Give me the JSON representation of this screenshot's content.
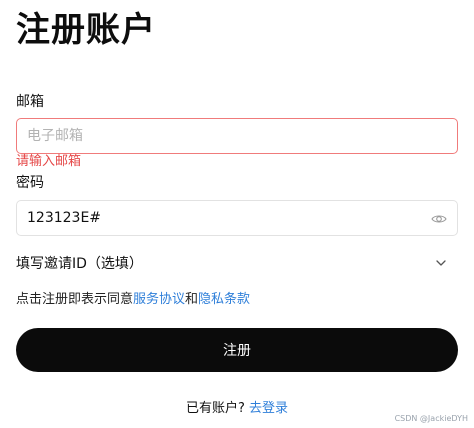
{
  "page": {
    "title": "注册账户"
  },
  "email": {
    "label": "邮箱",
    "placeholder": "电子邮箱",
    "value": "",
    "error": "请输入邮箱"
  },
  "password": {
    "label": "密码",
    "value": "123123E#",
    "icon": "eye-icon"
  },
  "invite": {
    "label": "填写邀请ID（选填）",
    "icon": "chevron-down-icon"
  },
  "agreement": {
    "prefix": "点击注册即表示同意",
    "service_link": "服务协议",
    "conj": "和",
    "privacy_link": "隐私条款"
  },
  "submit": {
    "label": "注册"
  },
  "login": {
    "prompt": "已有账户?",
    "link": "去登录"
  },
  "watermark": "CSDN @JackieDYH",
  "colors": {
    "error": "#e54848",
    "link": "#2f7fd9",
    "button_bg": "#0b0b0b"
  }
}
